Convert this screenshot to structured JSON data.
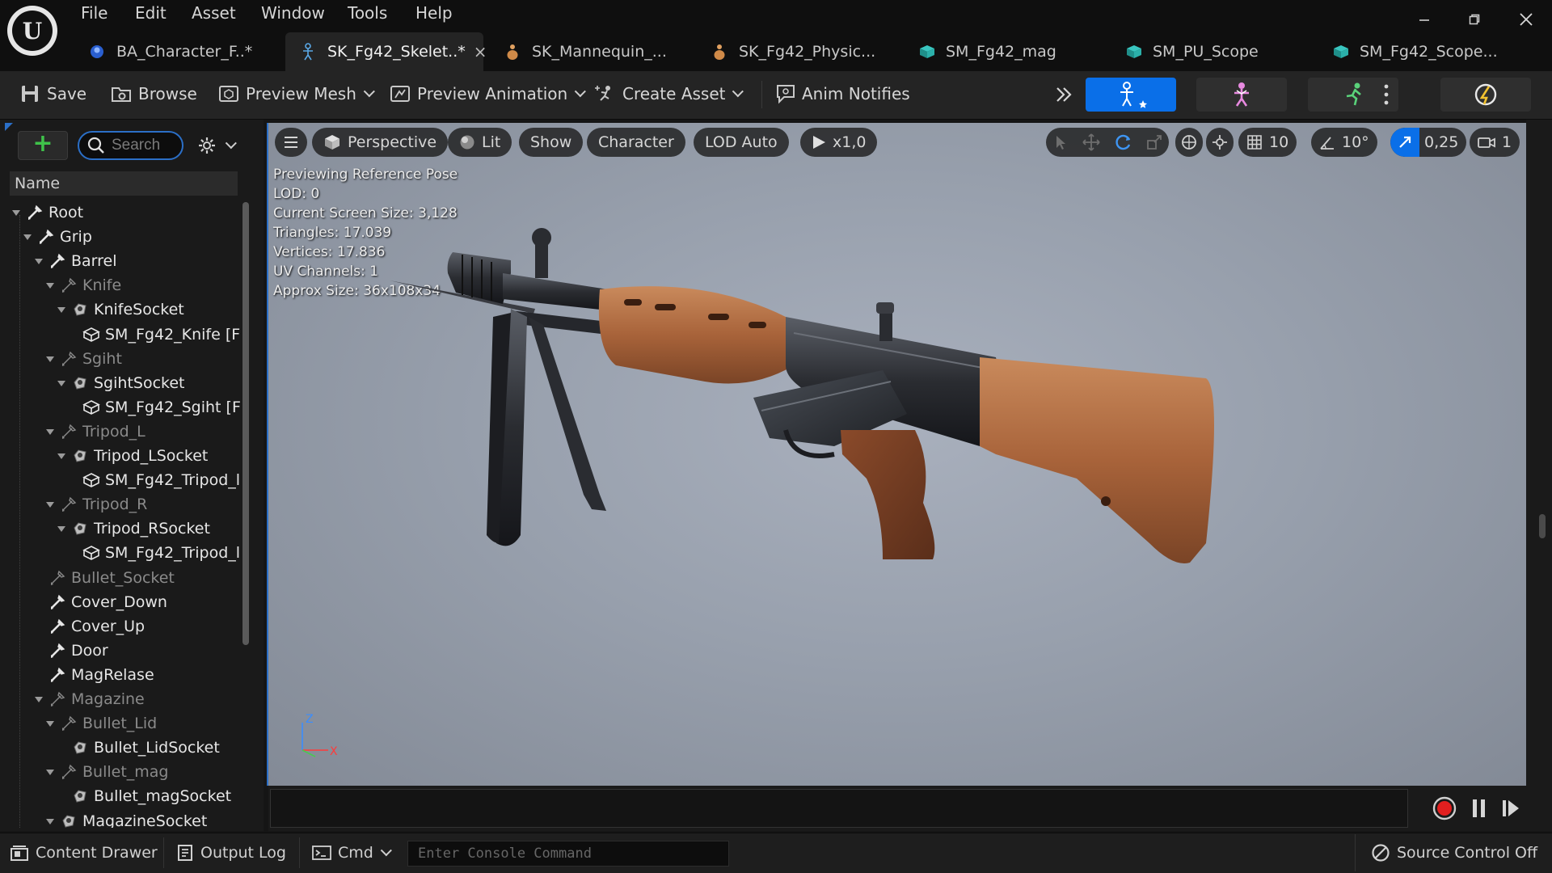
{
  "menu": [
    "File",
    "Edit",
    "Asset",
    "Window",
    "Tools",
    "Help"
  ],
  "tabs": [
    {
      "label": "BA_Character_F..*",
      "icon": "blueprint-actor-icon",
      "active": false
    },
    {
      "label": "SK_Fg42_Skelet..*",
      "icon": "skeleton-icon",
      "active": true
    },
    {
      "label": "SK_Mannequin_...",
      "icon": "skeletal-mesh-icon",
      "active": false
    },
    {
      "label": "SK_Fg42_Physic...",
      "icon": "physics-asset-icon",
      "active": false
    },
    {
      "label": "SM_Fg42_mag",
      "icon": "static-mesh-icon",
      "active": false
    },
    {
      "label": "SM_PU_Scope",
      "icon": "static-mesh-icon",
      "active": false
    },
    {
      "label": "SM_Fg42_Scope...",
      "icon": "static-mesh-icon",
      "active": false
    }
  ],
  "tab_close": "×",
  "toolbar": {
    "save": "Save",
    "browse": "Browse",
    "preview_mesh": "Preview Mesh",
    "preview_animation": "Preview Animation",
    "create_asset": "Create Asset",
    "anim_notifies": "Anim Notifies",
    "accent_color": "#0a6fe8"
  },
  "skeleton_tree": {
    "search_placeholder": "Search",
    "column_name": "Name",
    "rows": [
      {
        "label": "Root",
        "depth": 0,
        "kind": "bone",
        "expanded": true,
        "dim": false
      },
      {
        "label": "Grip",
        "depth": 1,
        "kind": "bone",
        "expanded": true,
        "dim": false
      },
      {
        "label": "Barrel",
        "depth": 2,
        "kind": "bone",
        "expanded": true,
        "dim": false
      },
      {
        "label": "Knife",
        "depth": 3,
        "kind": "bone",
        "expanded": true,
        "dim": true
      },
      {
        "label": "KnifeSocket",
        "depth": 4,
        "kind": "socket",
        "expanded": true,
        "dim": false
      },
      {
        "label": "SM_Fg42_Knife [F",
        "depth": 5,
        "kind": "mesh",
        "expanded": null,
        "dim": false
      },
      {
        "label": "Sgiht",
        "depth": 3,
        "kind": "bone",
        "expanded": true,
        "dim": true
      },
      {
        "label": "SgihtSocket",
        "depth": 4,
        "kind": "socket",
        "expanded": true,
        "dim": false
      },
      {
        "label": "SM_Fg42_Sgiht [F",
        "depth": 5,
        "kind": "mesh",
        "expanded": null,
        "dim": false
      },
      {
        "label": "Tripod_L",
        "depth": 3,
        "kind": "bone",
        "expanded": true,
        "dim": true
      },
      {
        "label": "Tripod_LSocket",
        "depth": 4,
        "kind": "socket",
        "expanded": true,
        "dim": false
      },
      {
        "label": "SM_Fg42_Tripod_l",
        "depth": 5,
        "kind": "mesh",
        "expanded": null,
        "dim": false
      },
      {
        "label": "Tripod_R",
        "depth": 3,
        "kind": "bone",
        "expanded": true,
        "dim": true
      },
      {
        "label": "Tripod_RSocket",
        "depth": 4,
        "kind": "socket",
        "expanded": true,
        "dim": false
      },
      {
        "label": "SM_Fg42_Tripod_l",
        "depth": 5,
        "kind": "mesh",
        "expanded": null,
        "dim": false
      },
      {
        "label": "Bullet_Socket",
        "depth": 2,
        "kind": "bone",
        "expanded": null,
        "dim": true
      },
      {
        "label": "Cover_Down",
        "depth": 2,
        "kind": "bone",
        "expanded": null,
        "dim": false
      },
      {
        "label": "Cover_Up",
        "depth": 2,
        "kind": "bone",
        "expanded": null,
        "dim": false
      },
      {
        "label": "Door",
        "depth": 2,
        "kind": "bone",
        "expanded": null,
        "dim": false
      },
      {
        "label": "MagRelase",
        "depth": 2,
        "kind": "bone",
        "expanded": null,
        "dim": false
      },
      {
        "label": "Magazine",
        "depth": 2,
        "kind": "bone",
        "expanded": true,
        "dim": true
      },
      {
        "label": "Bullet_Lid",
        "depth": 3,
        "kind": "bone",
        "expanded": true,
        "dim": true
      },
      {
        "label": "Bullet_LidSocket",
        "depth": 4,
        "kind": "socket",
        "expanded": null,
        "dim": false
      },
      {
        "label": "Bullet_mag",
        "depth": 3,
        "kind": "bone",
        "expanded": true,
        "dim": true
      },
      {
        "label": "Bullet_magSocket",
        "depth": 4,
        "kind": "socket",
        "expanded": null,
        "dim": false
      },
      {
        "label": "MagazineSocket",
        "depth": 3,
        "kind": "socket",
        "expanded": true,
        "dim": false
      }
    ]
  },
  "viewport": {
    "perspective": "Perspective",
    "lit": "Lit",
    "show": "Show",
    "character": "Character",
    "lod": "LOD Auto",
    "play_speed": "x1,0",
    "grid_size": "10",
    "rotation_snap": "10°",
    "scale_snap": "0,25",
    "camera_speed": "1",
    "stats": [
      "Previewing Reference Pose",
      "LOD: 0",
      "Current Screen Size: 3,128",
      "Triangles: 17.039",
      "Vertices: 17.836",
      "UV Channels: 1",
      "Approx Size: 36x108x34"
    ],
    "axis_z": "Z",
    "axis_x": "X"
  },
  "statusbar": {
    "content_drawer": "Content Drawer",
    "output_log": "Output Log",
    "cmd": "Cmd",
    "console_placeholder": "Enter Console Command",
    "source_control": "Source Control Off"
  }
}
